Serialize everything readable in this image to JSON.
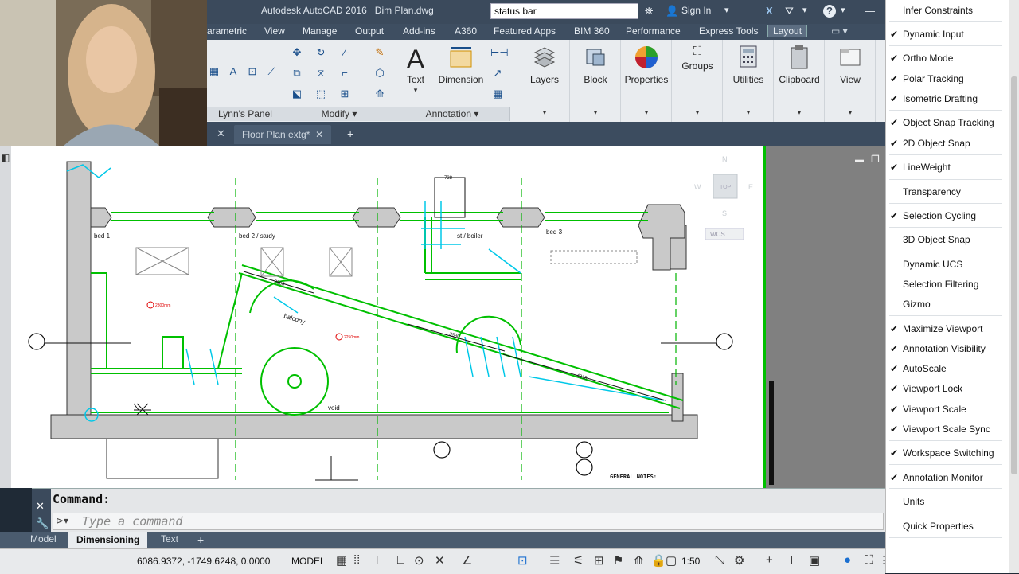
{
  "title_bar": {
    "app_title": "Autodesk AutoCAD 2016",
    "file_name": "Dim Plan.dwg",
    "search_value": "status bar",
    "sign_in": "Sign In",
    "help_icon": "?"
  },
  "ribbon_tabs": [
    "arametric",
    "View",
    "Manage",
    "Output",
    "Add-ins",
    "A360",
    "Featured Apps",
    "BIM 360",
    "Performance",
    "Express Tools",
    "Layout"
  ],
  "ribbon": {
    "panel_labels": {
      "lynns_panel": "Lynn's Panel",
      "modify": "Modify",
      "annotation": "Annotation"
    },
    "big_buttons": {
      "text": "Text",
      "dimension": "Dimension",
      "layers": "Layers",
      "block": "Block",
      "properties": "Properties",
      "groups": "Groups",
      "utilities": "Utilities",
      "clipboard": "Clipboard",
      "view": "View"
    }
  },
  "doc_tabs": {
    "file_tab": "Floor Plan extg*",
    "new_tab": "+"
  },
  "viewcube": {
    "top": "TOP",
    "wcs": "WCS",
    "west": "W",
    "east": "E",
    "south": "S",
    "north": "N"
  },
  "drawing_labels": {
    "bed1": "bed 1",
    "bed2": "bed 2 / study",
    "boiler": "st / boiler",
    "bed3": "bed 3",
    "balcony": "balcony",
    "void": "void",
    "general_notes": "GENERAL NOTES:",
    "dim1": "738",
    "dim2": "2586",
    "dim3": "3530",
    "dim4": "4310",
    "level1": "2800mm",
    "level2": "2250mm"
  },
  "command_line": {
    "history": "Command:",
    "placeholder": "Type a command"
  },
  "layout_tabs": [
    "Model",
    "Dimensioning",
    "Text"
  ],
  "layout_add": "+",
  "status_bar": {
    "coordinates": "6086.9372, -1749.6248, 0.0000",
    "space": "MODEL",
    "scale": "1:50"
  },
  "customization_menu": [
    {
      "label": "Infer Constraints",
      "checked": false
    },
    {
      "label": "Dynamic Input",
      "checked": true
    },
    {
      "label": "Ortho Mode",
      "checked": true
    },
    {
      "label": "Polar Tracking",
      "checked": true
    },
    {
      "label": "Isometric Drafting",
      "checked": true
    },
    {
      "label": "Object Snap Tracking",
      "checked": true
    },
    {
      "label": "2D Object Snap",
      "checked": true
    },
    {
      "label": "LineWeight",
      "checked": true
    },
    {
      "label": "Transparency",
      "checked": false
    },
    {
      "label": "Selection Cycling",
      "checked": true
    },
    {
      "label": "3D Object Snap",
      "checked": false
    },
    {
      "label": "Dynamic UCS",
      "checked": false
    },
    {
      "label": "Selection Filtering",
      "checked": false
    },
    {
      "label": "Gizmo",
      "checked": false
    },
    {
      "label": "Maximize Viewport",
      "checked": true
    },
    {
      "label": "Annotation Visibility",
      "checked": true
    },
    {
      "label": "AutoScale",
      "checked": true
    },
    {
      "label": "Viewport Lock",
      "checked": true
    },
    {
      "label": "Viewport Scale",
      "checked": true
    },
    {
      "label": "Viewport Scale Sync",
      "checked": true
    },
    {
      "label": "Workspace Switching",
      "checked": true
    },
    {
      "label": "Annotation Monitor",
      "checked": true
    },
    {
      "label": "Units",
      "checked": false
    },
    {
      "label": "Quick Properties",
      "checked": false
    }
  ],
  "colors": {
    "accent": "#00c000",
    "cyan": "#00c8e8",
    "ribbon": "#e9ecef",
    "dark": "#3b4a5c"
  }
}
